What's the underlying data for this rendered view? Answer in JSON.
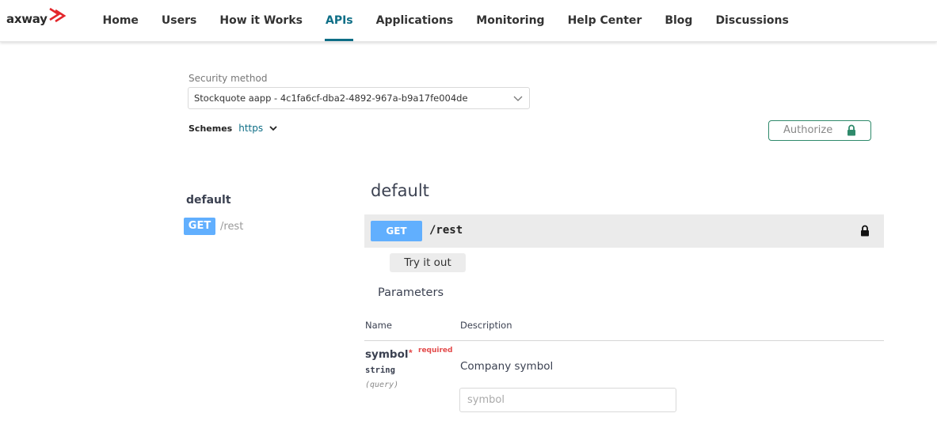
{
  "brand": {
    "logo_text": "axway",
    "accent": "#e3262b"
  },
  "nav": {
    "items": [
      {
        "label": "Home",
        "active": false
      },
      {
        "label": "Users",
        "active": false
      },
      {
        "label": "How it Works",
        "active": false
      },
      {
        "label": "APIs",
        "active": true
      },
      {
        "label": "Applications",
        "active": false
      },
      {
        "label": "Monitoring",
        "active": false
      },
      {
        "label": "Help Center",
        "active": false
      },
      {
        "label": "Blog",
        "active": false
      },
      {
        "label": "Discussions",
        "active": false
      }
    ],
    "active_color": "#0e6e86"
  },
  "security": {
    "label": "Security method",
    "selected": "Stockquote aapp - 4c1fa6cf-dba2-4892-967a-b9a17fe004de"
  },
  "schemes": {
    "label": "Schemes",
    "value": "https"
  },
  "authorize": {
    "label": "Authorize",
    "icon": "lock-icon",
    "border_color": "#2f8a6b"
  },
  "sidebar": {
    "title": "default",
    "operations": [
      {
        "method": "GET",
        "path": "/rest"
      }
    ]
  },
  "main": {
    "tag_title": "default",
    "operation": {
      "method": "GET",
      "path": "/rest",
      "method_color": "#61affe"
    },
    "try_it_out": "Try it out",
    "parameters": {
      "title": "Parameters",
      "columns": {
        "name": "Name",
        "description": "Description"
      },
      "items": [
        {
          "name": "symbol",
          "required_star": "*",
          "required_label": "required",
          "type": "string",
          "in": "(query)",
          "description": "Company symbol",
          "placeholder": "symbol"
        }
      ]
    }
  }
}
